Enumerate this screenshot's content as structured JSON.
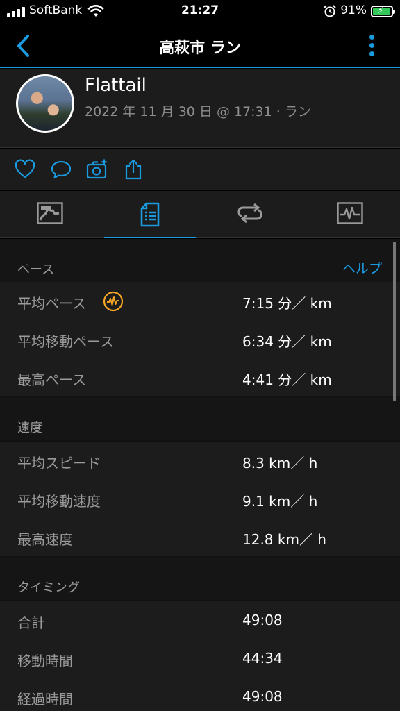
{
  "status": {
    "carrier": "SoftBank",
    "time": "21:27",
    "battery": "91%",
    "battery_level": 0.91
  },
  "nav": {
    "title": "高萩市 ラン"
  },
  "activity": {
    "user": "Flattail",
    "meta": "2022 年 11 月 30 日 @ 17:31 · ラン"
  },
  "sections": {
    "pace": {
      "title": "ペース",
      "help": "ヘルプ",
      "rows": [
        {
          "label": "平均ペース",
          "value": "7:15 分／ km"
        },
        {
          "label": "平均移動ペース",
          "value": "6:34 分／ km"
        },
        {
          "label": "最高ペース",
          "value": "4:41 分／ km"
        }
      ]
    },
    "speed": {
      "title": "速度",
      "rows": [
        {
          "label": "平均スピード",
          "value": "8.3 km／ h"
        },
        {
          "label": "平均移動速度",
          "value": "9.1 km／ h"
        },
        {
          "label": "最高速度",
          "value": "12.8 km／ h"
        }
      ]
    },
    "timing": {
      "title": "タイミング",
      "rows": [
        {
          "label": "合計",
          "value": "49:08"
        },
        {
          "label": "移動時間",
          "value": "44:34"
        },
        {
          "label": "経過時間",
          "value": "49:08"
        }
      ]
    }
  },
  "colors": {
    "accent": "#1a9be0",
    "pace_icon": "#f5a623"
  },
  "icons": {
    "back": "chevron-left-icon",
    "more": "more-vertical-icon",
    "like": "heart-icon",
    "comment": "comment-icon",
    "photo": "add-photo-icon",
    "share": "share-icon",
    "tabs": [
      "map-summary-icon",
      "stats-list-icon",
      "laps-icon",
      "chart-icon"
    ]
  }
}
